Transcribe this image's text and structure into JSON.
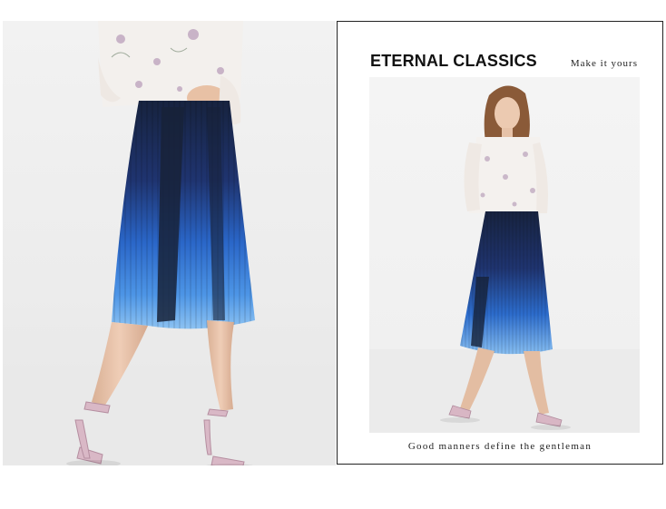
{
  "card": {
    "title": "ETERNAL CLASSICS",
    "subtitle": "Make it yours",
    "caption": "Good manners define the gentleman"
  },
  "colors": {
    "navy": "#1b2a4a",
    "royal_blue": "#2f6fd1",
    "light_blue": "#6fb3ee",
    "blouse": "#f4f1ee",
    "skin": "#e8c3a8",
    "sandal_pink": "#d8b6c4",
    "hair": "#8a5a38"
  }
}
